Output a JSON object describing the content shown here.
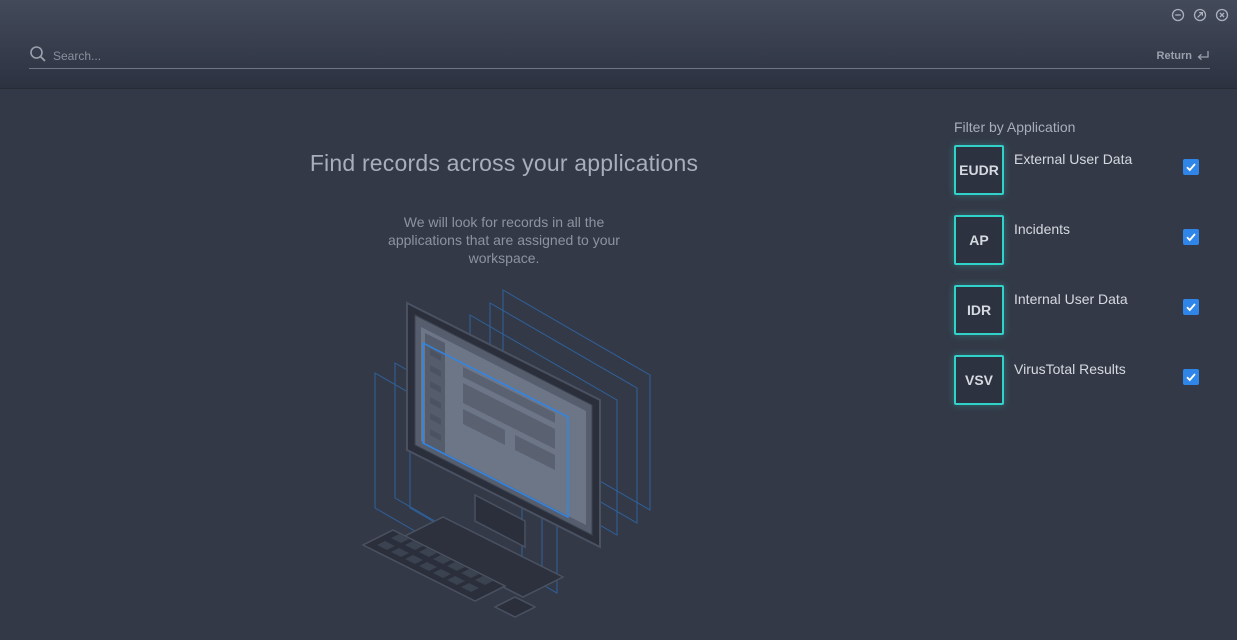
{
  "window": {
    "controls": [
      "minimize-icon",
      "restore-icon",
      "close-icon"
    ]
  },
  "search": {
    "placeholder": "Search...",
    "return_label": "Return"
  },
  "main": {
    "title": "Find records across your applications",
    "subtitle": "We will look for records in all the applications that are assigned to your workspace."
  },
  "filter": {
    "title": "Filter by Application",
    "apps": [
      {
        "badge": "EUDR",
        "name": "External User Data",
        "checked": true
      },
      {
        "badge": "AP",
        "name": "Incidents",
        "checked": true
      },
      {
        "badge": "IDR",
        "name": "Internal User Data",
        "checked": true
      },
      {
        "badge": "VSV",
        "name": "VirusTotal Results",
        "checked": true
      }
    ]
  },
  "colors": {
    "background": "#333947",
    "badge_border": "#2fd3c9",
    "checkbox": "#2f86e8"
  }
}
